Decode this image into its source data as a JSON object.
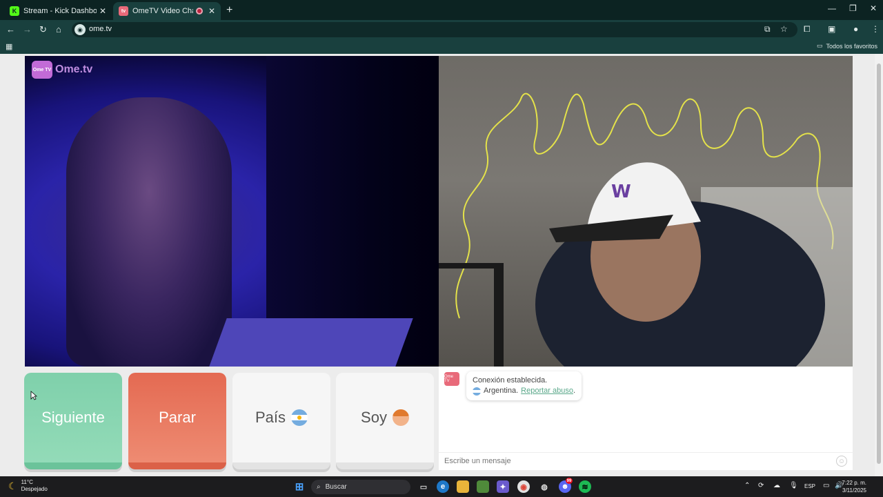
{
  "browser": {
    "tabs": [
      {
        "title": "Stream - Kick Dashboard",
        "favicon": "kick-icon",
        "active": false
      },
      {
        "title": "OmeTV Video Chat — Omeg",
        "favicon": "ometv-icon",
        "active": true
      }
    ],
    "url": "ome.tv",
    "bookmarks_all": "Todos los favoritos"
  },
  "page": {
    "logo_text": "Ome.tv",
    "logo_badge": "Ome TV",
    "buttons": {
      "next": "Siguiente",
      "stop": "Parar",
      "country": "País",
      "gender": "Soy"
    },
    "chat": {
      "status": "Conexión establecida.",
      "country": "Argentina.",
      "report": "Reportar abuso",
      "report_suffix": ".",
      "input_placeholder": "Escribe un mensaje"
    }
  },
  "taskbar": {
    "weather_temp": "11°C",
    "weather_desc": "Despejado",
    "search_label": "Buscar",
    "language": "ESP",
    "time": "7:22 p. m.",
    "date": "3/11/2025",
    "notification_count": "99"
  },
  "colors": {
    "next": "#86d5b1",
    "stop": "#e8755c",
    "link": "#5aa88a",
    "browser_frame": "#19403e"
  }
}
